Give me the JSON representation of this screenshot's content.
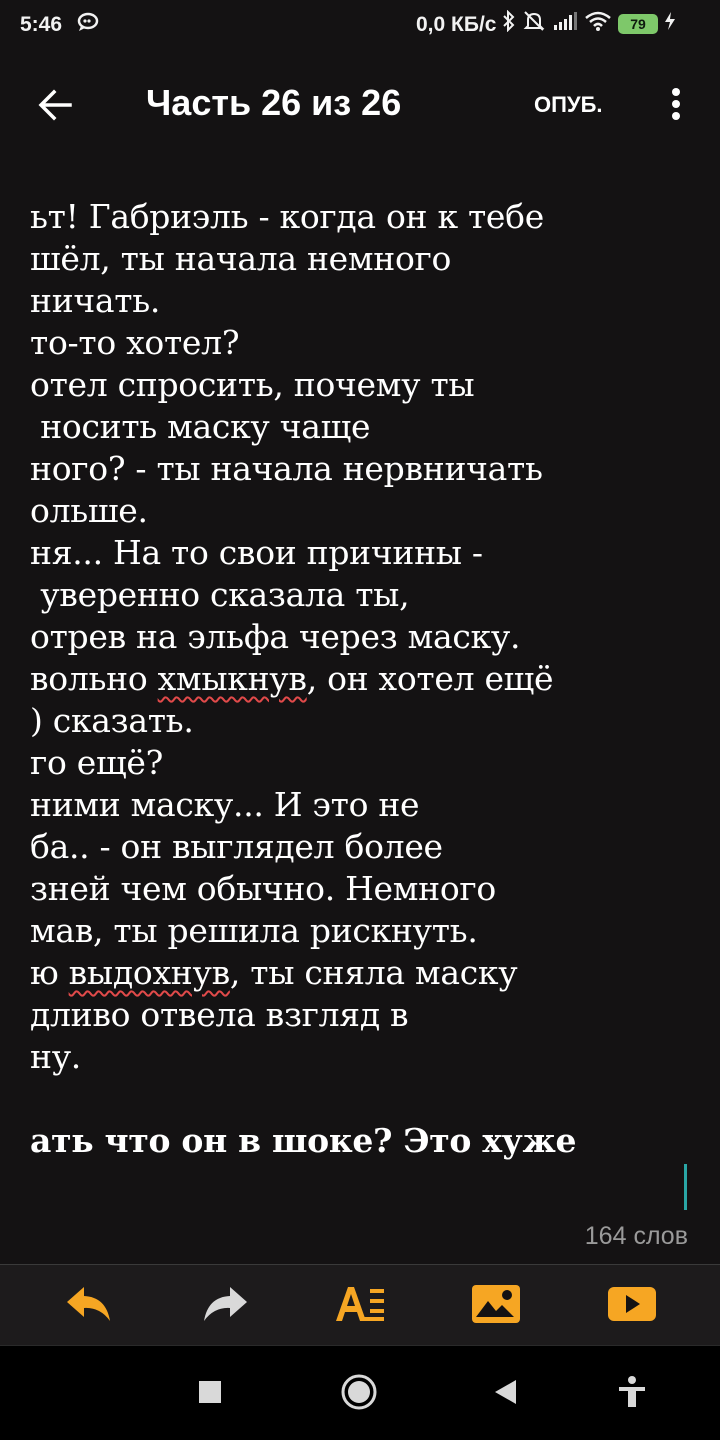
{
  "status_bar": {
    "time": "5:46",
    "notification_icon": "chat-bubble-icon",
    "network_speed": "0,0 КБ/с",
    "battery_level": "79",
    "icons": [
      "bluetooth-icon",
      "silent-icon",
      "signal-icon",
      "wifi-icon",
      "battery-icon",
      "charging-icon"
    ]
  },
  "top_bar": {
    "title": "Часть 26 из 26",
    "publish_label": "ОПУБ."
  },
  "content": {
    "lines": [
      "ьт! Габриэль - когда он к тебе",
      "шёл, ты начала немного",
      "ничать.",
      "то-то хотел?",
      "отел спросить, почему ты",
      " носить маску чаще",
      "ного? - ты начала нервничать",
      "ольше.",
      "ня... На то свои причины -",
      " уверенно сказала ты,",
      "отрев на эльфа через маску.",
      "вольно ",
      ") сказать.",
      "го ещё?",
      "ними маску... И это не",
      "ба.. - он выглядел более",
      "зней чем обычно. Немного",
      "мав, ты решила рискнуть.",
      "ю ",
      "дливо отвела взгляд в",
      "ну."
    ],
    "line12_misspelled": "хмыкнув",
    "line12_rest": ", он хотел ещё",
    "line19_misspelled": "выдохнув",
    "line19_rest": ", ты сняла маску",
    "bold_line": "ать что он в шоке? Это хуже"
  },
  "word_count": "164 слов",
  "accent_color": "#f6a623",
  "toolbar": {
    "items": [
      "undo-icon",
      "redo-icon",
      "text-format-icon",
      "image-icon",
      "video-icon"
    ]
  },
  "nav_bar": {
    "items": [
      "recents-square-icon",
      "home-circle-icon",
      "back-triangle-icon",
      "accessibility-icon"
    ]
  }
}
